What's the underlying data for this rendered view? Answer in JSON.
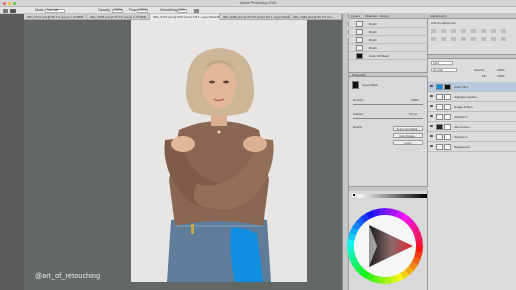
{
  "window": {
    "title": "Adobe Photoshop 2019"
  },
  "options_bar": {
    "tool": "Brush",
    "mode_label": "Mode:",
    "mode_value": "Normal",
    "opacity_label": "Opacity:",
    "opacity_value": "100%",
    "flow_label": "Flow:",
    "flow_value": "100%",
    "smoothing_label": "Smoothing:",
    "smoothing_value": "10%"
  },
  "document_tabs": [
    {
      "label": "IMG_5474.psd @ 66.7% (Layer 1, RGB/8)"
    },
    {
      "label": "IMG_5478.psd @ 66.7% (Layer 2, RGB/8)"
    },
    {
      "label": "IMG_5479.psd @ 50% (Color Fill 1, Layer Mask/8)",
      "active": true
    },
    {
      "label": "IMG_5480.psd @ 66.7% (Color Fill 1, Layer Mask/8)"
    },
    {
      "label": "IMG_5482.psd @ 66.7% (Co..."
    }
  ],
  "history_panel": {
    "tabs": [
      "Layers",
      "Channels",
      "History"
    ],
    "rows": [
      "Brush",
      "Brush",
      "Brush",
      "Brush",
      "Color Fill Mask"
    ]
  },
  "properties_panel": {
    "tab": "Properties",
    "title": "Layer Mask",
    "density_label": "Density:",
    "density_value": "100%",
    "feather_label": "Feather:",
    "feather_value": "0.0 px",
    "refine_label": "Refine:",
    "buttons": [
      "Select and Mask...",
      "Color Range...",
      "Invert"
    ]
  },
  "adjustments_panel": {
    "title": "Adjustments",
    "subtitle": "Add an adjustment"
  },
  "layers_panel": {
    "kind_label": "Kind",
    "mode_value": "Normal",
    "opacity_label": "Opacity:",
    "opacity_value": "100%",
    "fill_label": "Fill:",
    "fill_value": "100%",
    "layers": [
      {
        "name": "Color Fill 1",
        "thumb": "#0a8fe6"
      },
      {
        "name": "Highlight solution"
      },
      {
        "name": "Dodge & Burn"
      },
      {
        "name": "Shadow 1"
      },
      {
        "name": "Skin texture",
        "thumb": "#222"
      },
      {
        "name": "Shadow 2"
      },
      {
        "name": "Background"
      }
    ]
  },
  "color_wheel_panel": {},
  "watermark": "@art_of_retouching",
  "colors": {
    "accent_blue": "#0a8fe6",
    "panel_bg": "#d7d7d7",
    "canvas_bg": "#646865",
    "wheel_triangle_hue": "#e4262b"
  }
}
